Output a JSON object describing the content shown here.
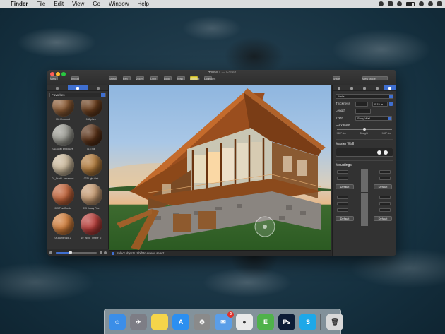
{
  "menubar": {
    "app_name": "Finder",
    "items": [
      "File",
      "Edit",
      "View",
      "Go",
      "Window",
      "Help"
    ]
  },
  "window": {
    "title": "House 1",
    "subtitle": "— Edited",
    "toolbar_left": [
      "View",
      "Import"
    ],
    "toolbar_center": [
      "Select",
      "Pan",
      "Zoom",
      "Orbit",
      "Look",
      "Walk",
      "Lighting",
      "Collisions"
    ],
    "toolbar_right": [
      "Share",
      "View Mode"
    ]
  },
  "sidebar": {
    "favorites_label": "Favorites",
    "materials": [
      {
        "name": "004 Firewood",
        "color": "#8a5a34"
      },
      {
        "name": "008 plane",
        "color": "#6b3f1e"
      },
      {
        "name": "011 Gray Enclosure",
        "color": "#9a9a92"
      },
      {
        "name": "016 Soil",
        "color": "#5a3218"
      },
      {
        "name": "01_Rubbl...ornament",
        "color": "#c9b79a"
      },
      {
        "name": "022 Light Oak",
        "color": "#b07a3c"
      },
      {
        "name": "023 Pine Bonds",
        "color": "#c0633a"
      },
      {
        "name": "033 Heavy Pine",
        "color": "#c49a72"
      },
      {
        "name": "063 Ambrosia 2",
        "color": "#cf7d3b"
      },
      {
        "name": "10_Wind_Timber_2",
        "color": "#b73e3a"
      }
    ]
  },
  "status": {
    "text": "Select objects. Shift to extend select."
  },
  "inspector": {
    "type_select": "Walls",
    "thickness_label": "Thickness",
    "thickness_value": "0.15 m",
    "length_label": "Length",
    "type_label": "Type",
    "type_value": "Story Wall",
    "curvature_label": "Curvature",
    "curvature_left": "+180° Arc",
    "curvature_mid": "Straight",
    "curvature_right": "+180° Arc",
    "master_wall_label": "Master Wall",
    "mouldings_label": "Mouldings",
    "default_labels": [
      "Default",
      "Default",
      "Default",
      "Default"
    ]
  },
  "dock": {
    "apps": [
      {
        "name": "Finder",
        "color": "#3b8ee8",
        "glyph": "☺"
      },
      {
        "name": "Launchpad",
        "color": "#7d7d85",
        "glyph": "✈"
      },
      {
        "name": "Notes",
        "color": "#f5d54a",
        "glyph": ""
      },
      {
        "name": "App Store",
        "color": "#2c8ff0",
        "glyph": "A"
      },
      {
        "name": "System Preferences",
        "color": "#8a8a8a",
        "glyph": "⚙"
      },
      {
        "name": "Mail",
        "color": "#5a9ee8",
        "glyph": "✉",
        "badge": "2"
      },
      {
        "name": "Chrome",
        "color": "#e9e9e9",
        "glyph": "●"
      },
      {
        "name": "Evernote",
        "color": "#4fb24a",
        "glyph": "E"
      },
      {
        "name": "Photoshop",
        "color": "#0c1c36",
        "glyph": "Ps"
      },
      {
        "name": "Skype",
        "color": "#1ea8e8",
        "glyph": "S"
      },
      {
        "name": "Trash",
        "color": "#d9d9d9",
        "glyph": "🗑"
      }
    ]
  }
}
